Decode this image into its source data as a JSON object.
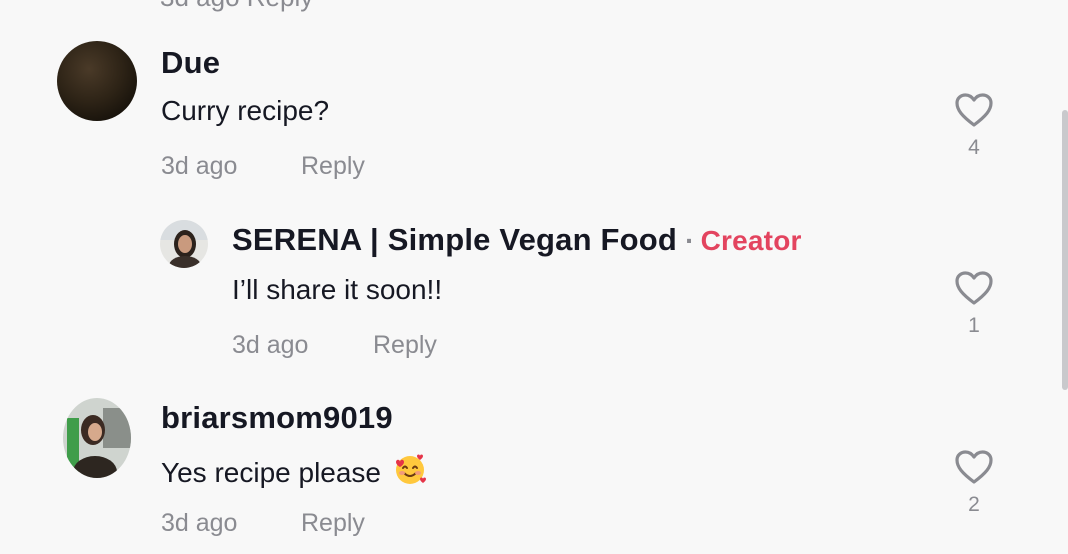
{
  "top_partial": "3d ago   Reply",
  "comments": [
    {
      "username": "Due",
      "text": "Curry recipe?",
      "time": "3d ago",
      "reply_label": "Reply",
      "likes": "4"
    },
    {
      "username": "SERENA | Simple Vegan Food",
      "separator": "·",
      "badge": "Creator",
      "text": "I’ll share it soon!!",
      "time": "3d ago",
      "reply_label": "Reply",
      "likes": "1"
    },
    {
      "username": "briarsmom9019",
      "text": "Yes recipe please",
      "emoji": "smiling-face-with-hearts",
      "time": "3d ago",
      "reply_label": "Reply",
      "likes": "2"
    }
  ],
  "colors": {
    "background": "#f8f8f8",
    "text_primary": "#161823",
    "text_secondary": "#8a8b91",
    "creator_badge": "#e3445f"
  },
  "icons": {
    "like": "heart-outline-icon"
  }
}
